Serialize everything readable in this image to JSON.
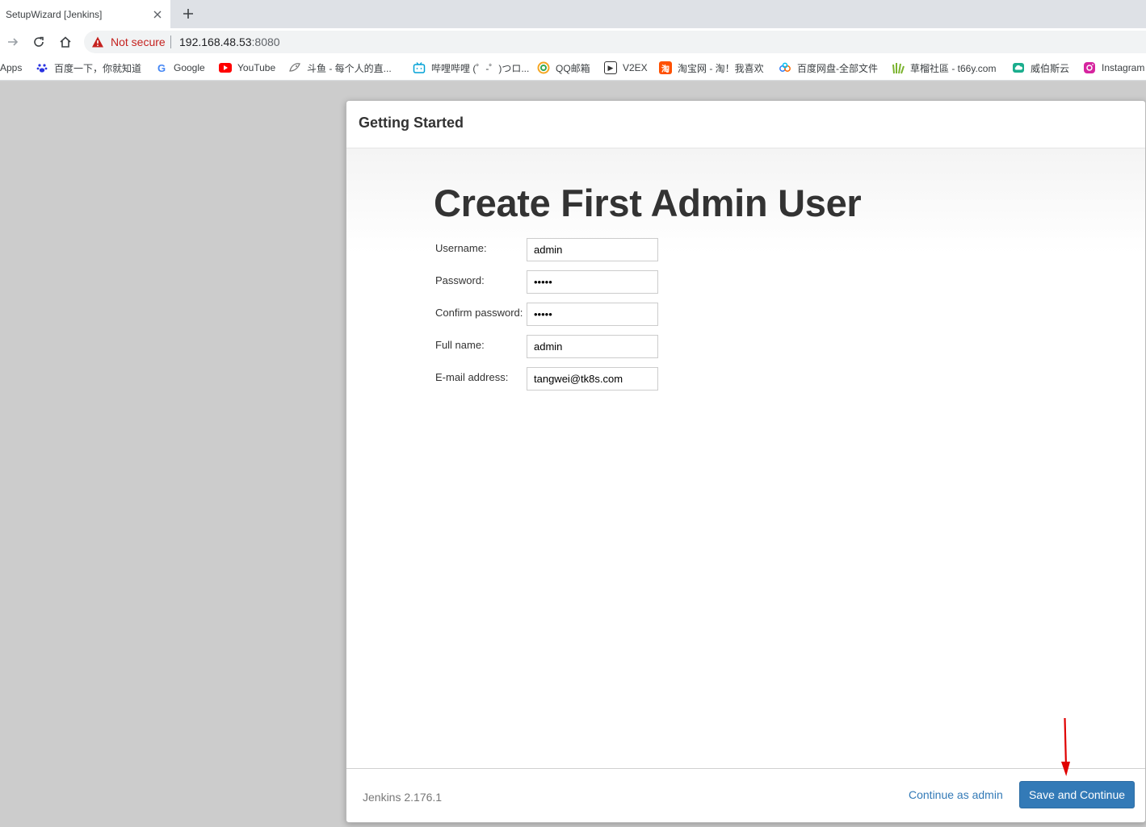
{
  "browser": {
    "tab_title": "SetupWizard [Jenkins]",
    "security_label": "Not secure",
    "url_host": "192.168.48.53",
    "url_port": ":8080"
  },
  "bookmarks": [
    {
      "label": "Apps",
      "icon": "apps-grid-icon"
    },
    {
      "label": "百度一下，你就知道",
      "icon": "baidu-paw-icon",
      "color": "#2932e1"
    },
    {
      "label": "Google",
      "icon": "google-g-icon",
      "color": "#4285f4"
    },
    {
      "label": "YouTube",
      "icon": "youtube-play-icon",
      "color": "#ff0000"
    },
    {
      "label": "斗鱼 - 每个人的直...",
      "icon": "douyu-fish-icon",
      "color": "#888888"
    },
    {
      "label": "哔哩哔哩 (゜-゜)つロ...",
      "icon": "bilibili-tv-icon",
      "color": "#00a1d6"
    },
    {
      "label": "QQ邮箱",
      "icon": "qq-mail-icon",
      "color": "#f5a623"
    },
    {
      "label": "V2EX",
      "icon": "v2ex-icon",
      "color": "#333333"
    },
    {
      "label": "淘宝网 - 淘！我喜欢",
      "icon": "taobao-icon",
      "color": "#ff5000"
    },
    {
      "label": "百度网盘-全部文件",
      "icon": "baidu-cloud-icon",
      "color": "#2e7bf6"
    },
    {
      "label": "草榴社區 - t66y.com",
      "icon": "grass-icon",
      "color": "#7bb32e"
    },
    {
      "label": "威伯斯云",
      "icon": "cloud-icon",
      "color": "#1aad8d"
    },
    {
      "label": "Instagram",
      "icon": "instagram-icon",
      "color": "#d6249f"
    }
  ],
  "modal": {
    "header_title": "Getting Started",
    "heading": "Create First Admin User",
    "fields": [
      {
        "label": "Username:",
        "value": "admin",
        "type": "text"
      },
      {
        "label": "Password:",
        "value": "admin",
        "type": "password"
      },
      {
        "label": "Confirm password:",
        "value": "admin",
        "type": "password"
      },
      {
        "label": "Full name:",
        "value": "admin",
        "type": "text"
      },
      {
        "label": "E-mail address:",
        "value": "tangwei@tk8s.com",
        "type": "text"
      }
    ],
    "version": "Jenkins 2.176.1",
    "continue_as_admin": "Continue as admin",
    "save_and_continue": "Save and Continue"
  },
  "colors": {
    "primary": "#337ab7",
    "warning": "#c5221f",
    "annotation_arrow": "#e00000"
  }
}
